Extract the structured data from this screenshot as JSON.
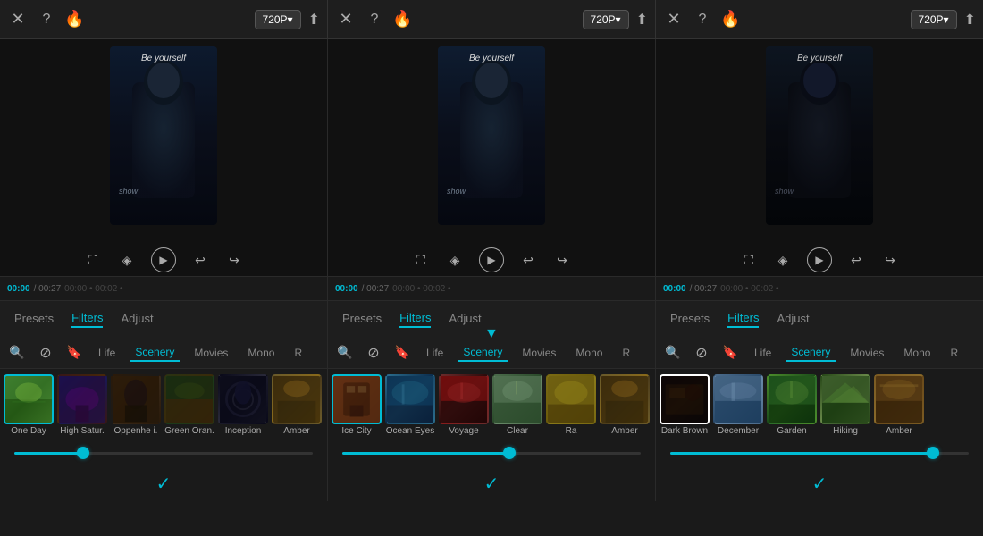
{
  "panels": [
    {
      "id": "panel1",
      "toolbar": {
        "close_label": "×",
        "help_label": "?",
        "quality": "720P▾",
        "upload_icon": "upload"
      },
      "preview": {
        "text_top": "Be yourself",
        "text_bottom": "show",
        "play_label": "▶"
      },
      "timeline": {
        "current": "00:00",
        "total": "00:27",
        "ticks": [
          "00:00",
          "•",
          "00:02",
          "•"
        ]
      },
      "tabs": [
        "Presets",
        "Filters",
        "Adjust"
      ],
      "active_tab": "Filters",
      "filter_categories": [
        "Life",
        "Scenery",
        "Movies",
        "Mono",
        "R"
      ],
      "active_category": "Scenery",
      "filter_items": [
        {
          "label": "One Day",
          "class": "ft-oneday",
          "selected": true
        },
        {
          "label": "High Satur.",
          "class": "ft-highsatur",
          "selected": false
        },
        {
          "label": "Oppenhe i.",
          "class": "ft-oppenheimer",
          "selected": false
        },
        {
          "label": "Green Oran.",
          "class": "ft-greenorange",
          "selected": false
        },
        {
          "label": "Inception",
          "class": "ft-inception",
          "selected": false
        },
        {
          "label": "Amber",
          "class": "ft-amber",
          "selected": false
        }
      ],
      "slider_value": 23,
      "check_label": "✓"
    },
    {
      "id": "panel2",
      "toolbar": {
        "close_label": "×",
        "help_label": "?",
        "quality": "720P▾",
        "upload_icon": "upload"
      },
      "preview": {
        "text_top": "Be yourself",
        "text_bottom": "show",
        "play_label": "▶"
      },
      "timeline": {
        "current": "00:00",
        "total": "00:27",
        "ticks": [
          "00:00",
          "•",
          "00:02",
          "•"
        ]
      },
      "tabs": [
        "Presets",
        "Filters",
        "Adjust"
      ],
      "active_tab": "Filters",
      "filter_categories": [
        "Life",
        "Scenery",
        "Movies",
        "Mono",
        "R"
      ],
      "active_category": "Scenery",
      "filter_items": [
        {
          "label": "Ice City",
          "class": "ft-icecity",
          "selected": true
        },
        {
          "label": "Ocean Eyes",
          "class": "ft-oceaneyes",
          "selected": false
        },
        {
          "label": "Voyage",
          "class": "ft-voyage",
          "selected": false
        },
        {
          "label": "Clear",
          "class": "ft-clear",
          "selected": false
        },
        {
          "label": "Ra",
          "class": "ft-ra",
          "selected": false
        },
        {
          "label": "Amber",
          "class": "ft-amber",
          "selected": false
        }
      ],
      "slider_value": 56,
      "check_label": "✓"
    },
    {
      "id": "panel3",
      "toolbar": {
        "close_label": "×",
        "help_label": "?",
        "quality": "720P▾",
        "upload_icon": "upload"
      },
      "preview": {
        "text_top": "Be yourself",
        "text_bottom": "show",
        "play_label": "▶"
      },
      "timeline": {
        "current": "00:00",
        "total": "00:27",
        "ticks": [
          "00:00",
          "•",
          "00:02",
          "•"
        ]
      },
      "tabs": [
        "Presets",
        "Filters",
        "Adjust"
      ],
      "active_tab": "Filters",
      "filter_categories": [
        "Life",
        "Scenery",
        "Movies",
        "Mono",
        "R"
      ],
      "active_category": "Scenery",
      "filter_items": [
        {
          "label": "Dark Brown",
          "class": "ft-darkbrown",
          "selected": true
        },
        {
          "label": "December",
          "class": "ft-december",
          "selected": false
        },
        {
          "label": "Garden",
          "class": "ft-garden",
          "selected": false
        },
        {
          "label": "Hiking",
          "class": "ft-hiking",
          "selected": false
        },
        {
          "label": "Amber",
          "class": "ft-amber2",
          "selected": false
        }
      ],
      "slider_value": 88,
      "check_label": "✓"
    }
  ],
  "icons": {
    "close": "✕",
    "help": "?",
    "search": "🔍",
    "no": "⊘",
    "bookmark": "🔖",
    "undo": "↩",
    "redo": "↪",
    "fullscreen": "⛶",
    "diamond": "◈",
    "upload": "⬆"
  }
}
